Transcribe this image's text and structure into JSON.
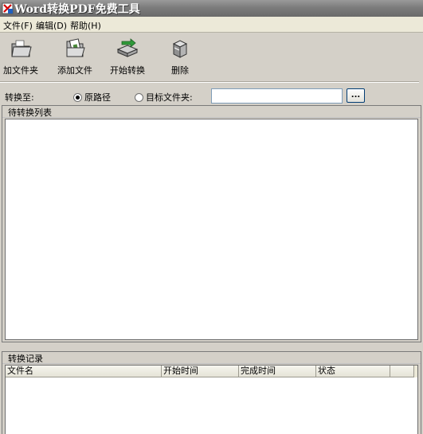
{
  "window": {
    "title": "Word转换PDF免费工具"
  },
  "menu": [
    {
      "label": "文件(F)"
    },
    {
      "label": "编辑(D)"
    },
    {
      "label": "帮助(H)"
    }
  ],
  "toolbar": {
    "add_folder": "加文件夹",
    "add_file": "添加文件",
    "start_convert": "开始转换",
    "delete": "删除"
  },
  "destination": {
    "label": "转换至:",
    "option_original": "原路径",
    "option_target": "目标文件夹:",
    "selected": "original",
    "path_value": "",
    "browse_label": "..."
  },
  "pending_panel": {
    "title": "待转换列表"
  },
  "log_panel": {
    "title": "转换记录",
    "columns": [
      "文件名",
      "开始时间",
      "完成时间",
      "状态"
    ]
  },
  "colors": {
    "title_bar": "#7c7c7c",
    "face": "#d4d0c8",
    "list_bg": "#ffffff"
  }
}
